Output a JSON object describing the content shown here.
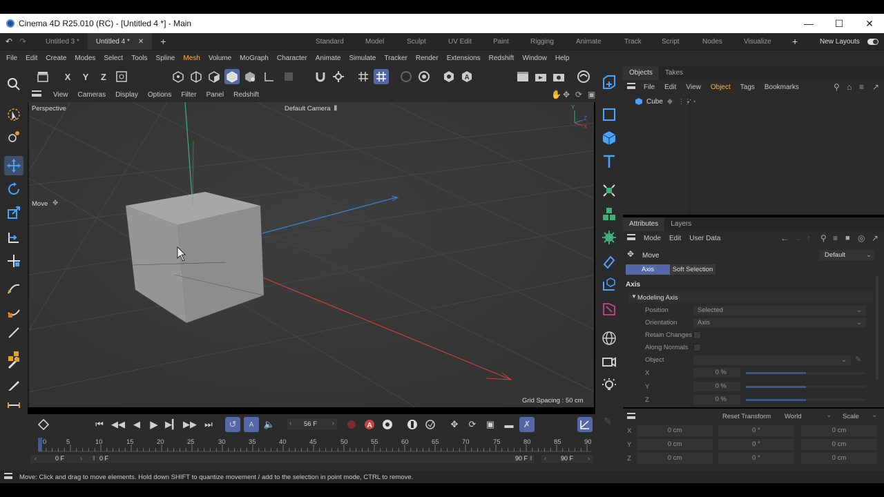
{
  "window": {
    "title": "Cinema 4D R25.010 (RC) - [Untitled 4 *] - Main"
  },
  "doc_tabs": [
    "Untitled 3 *",
    "Untitled 4 *"
  ],
  "layouts": [
    "Standard",
    "Model",
    "Sculpt",
    "UV Edit",
    "Paint",
    "Rigging",
    "Animate",
    "Track",
    "Script",
    "Nodes",
    "Visualize"
  ],
  "new_layouts": "New Layouts",
  "menu": [
    "File",
    "Edit",
    "Create",
    "Modes",
    "Select",
    "Tools",
    "Spline",
    "Mesh",
    "Volume",
    "MoGraph",
    "Character",
    "Animate",
    "Simulate",
    "Tracker",
    "Render",
    "Extensions",
    "Redshift",
    "Window",
    "Help"
  ],
  "axis_buttons": {
    "x": "X",
    "y": "Y",
    "z": "Z"
  },
  "viewport_menu": [
    "View",
    "Cameras",
    "Display",
    "Options",
    "Filter",
    "Panel",
    "Redshift"
  ],
  "viewport": {
    "name": "Perspective",
    "camera": "Default Camera",
    "tool_label": "Move",
    "grid_spacing": "Grid Spacing : 50 cm",
    "axis_labels": {
      "y": "Y",
      "z": "Z",
      "x": "X"
    }
  },
  "objects_panel": {
    "tabs": [
      "Objects",
      "Takes"
    ],
    "menu": [
      "File",
      "Edit",
      "View",
      "Object",
      "Tags",
      "Bookmarks"
    ],
    "items": [
      {
        "name": "Cube"
      }
    ]
  },
  "attributes_panel": {
    "tabs": [
      "Attributes",
      "Layers"
    ],
    "menu": [
      "Mode",
      "Edit",
      "User Data"
    ],
    "tool": "Move",
    "preset": "Default",
    "subtabs": [
      "Axis",
      "Soft Selection"
    ],
    "section": "Axis",
    "group": "Modeling Axis",
    "rows": [
      {
        "label": "Position",
        "value": "Selected"
      },
      {
        "label": "Orientation",
        "value": "Axis"
      },
      {
        "label": "Retain Changes",
        "value": ""
      },
      {
        "label": "Along Normals",
        "value": ""
      },
      {
        "label": "Object",
        "value": ""
      }
    ],
    "sliders": [
      {
        "label": "X",
        "value": "0 %"
      },
      {
        "label": "Y",
        "value": "0 %"
      },
      {
        "label": "Z",
        "value": "0 %"
      }
    ]
  },
  "coordinates": {
    "reset": "Reset Transform",
    "space": "World",
    "mode": "Scale",
    "rows": [
      {
        "axis": "X",
        "pos": "0 cm",
        "rot": "0 °",
        "scale": "0 cm"
      },
      {
        "axis": "Y",
        "pos": "0 cm",
        "rot": "0 °",
        "scale": "0 cm"
      },
      {
        "axis": "Z",
        "pos": "0 cm",
        "rot": "0 °",
        "scale": "0 cm"
      }
    ]
  },
  "timeline": {
    "current_frame": "56 F",
    "ticks": [
      "0",
      "5",
      "10",
      "15",
      "20",
      "25",
      "30",
      "35",
      "40",
      "45",
      "50",
      "55",
      "60",
      "65",
      "70",
      "75",
      "80",
      "85",
      "90"
    ],
    "start": "0 F",
    "range_start": "0 F",
    "range_end": "90 F",
    "end": "90 F"
  },
  "status": "Move: Click and drag to move elements. Hold down SHIFT to quantize movement / add to the selection in point mode, CTRL to remove.",
  "colors": {
    "accent": "#5468a8",
    "highlight": "#ffb347",
    "x_axis": "#d04040",
    "y_axis": "#3fb07a",
    "z_axis": "#3a7fd0"
  }
}
